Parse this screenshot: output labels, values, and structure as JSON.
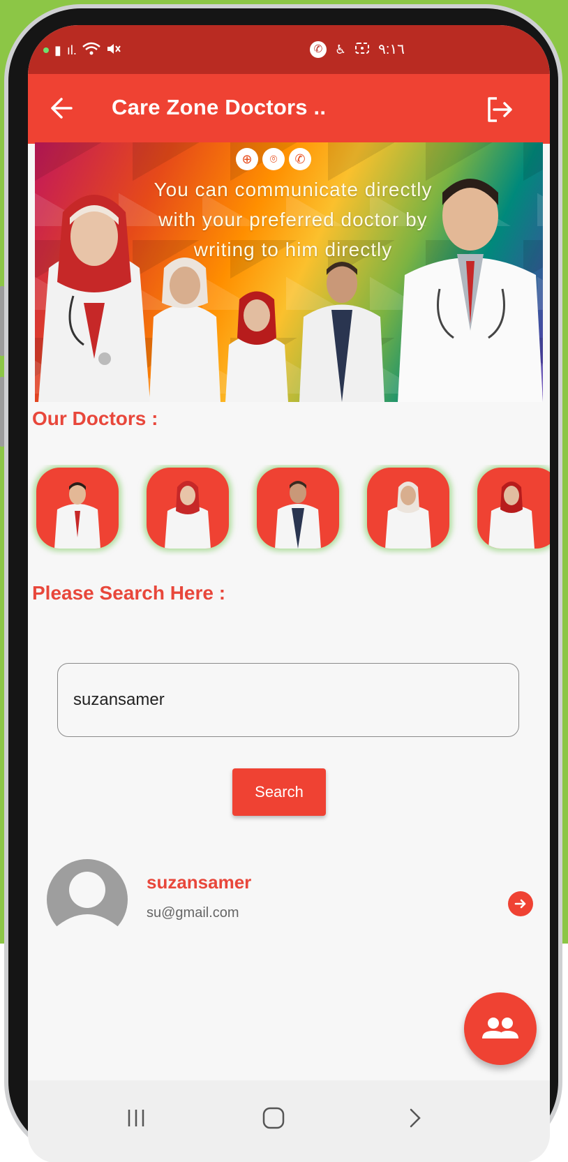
{
  "status_bar": {
    "time": "٩:١٦"
  },
  "app_bar": {
    "title": "Care Zone Doctors .."
  },
  "banner": {
    "headline_line1": "You can communicate directly",
    "headline_line2": "with your preferred doctor by",
    "headline_line3": "writing to him directly",
    "icons": [
      "globe-icon",
      "location-pin-icon",
      "phone-icon"
    ]
  },
  "doctors_section": {
    "heading": "Our Doctors :"
  },
  "search_section": {
    "heading": "Please Search Here  :",
    "input_value": "suzansamer",
    "button_label": "Search"
  },
  "result": {
    "name": "suzansamer",
    "email": "su@gmail.com"
  },
  "colors": {
    "primary": "#ef4233",
    "status_bar": "#b92b22",
    "heading": "#e8473b",
    "backdrop": "#8cc646"
  }
}
